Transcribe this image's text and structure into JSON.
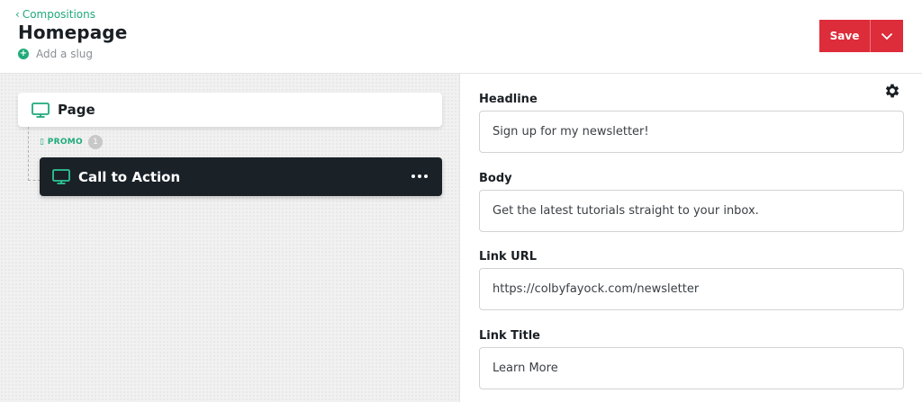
{
  "header": {
    "back_label": "Compositions",
    "title": "Homepage",
    "slug_label": "Add a slug",
    "save_label": "Save"
  },
  "canvas": {
    "root_node": {
      "label": "Page",
      "icon": "monitor-icon"
    },
    "slot": {
      "label": "PROMO",
      "count": "1"
    },
    "child_node": {
      "label": "Call to Action",
      "icon": "monitor-icon"
    }
  },
  "panel": {
    "fields": [
      {
        "label": "Headline",
        "value": "Sign up for my newsletter!"
      },
      {
        "label": "Body",
        "value": "Get the latest tutorials straight to your inbox."
      },
      {
        "label": "Link URL",
        "value": "https://colbyfayock.com/newsletter"
      },
      {
        "label": "Link Title",
        "value": "Learn More"
      }
    ]
  },
  "colors": {
    "accent_green": "#1faa7a",
    "save_red": "#dd2c3a",
    "dark_node": "#1a2127"
  }
}
